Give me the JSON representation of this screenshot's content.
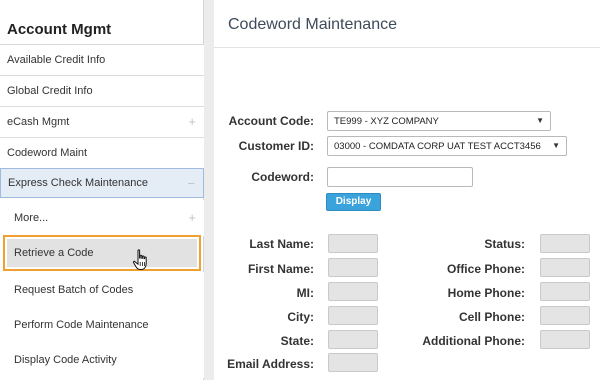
{
  "sidebar": {
    "title": "Account Mgmt",
    "items": [
      {
        "label": "Available Credit Info"
      },
      {
        "label": "Global Credit Info"
      },
      {
        "label": "eCash Mgmt",
        "icon": "plus-icon"
      },
      {
        "label": "Codeword Maint"
      },
      {
        "label": "Express Check Maintenance",
        "icon": "minus-icon"
      }
    ],
    "subitems": [
      {
        "label": "More...",
        "icon": "plus-icon"
      },
      {
        "label": "Retrieve a Code"
      },
      {
        "label": "Request Batch of Codes"
      },
      {
        "label": "Perform Code Maintenance"
      },
      {
        "label": "Display Code Activity"
      }
    ],
    "highlight_color": "#f0a030"
  },
  "main": {
    "title": "Codeword Maintenance",
    "form": {
      "account_code_label": "Account Code:",
      "account_code_value": "TE999 - XYZ COMPANY",
      "customer_id_label": "Customer ID:",
      "customer_id_value": "03000 - COMDATA CORP UAT TEST ACCT3456",
      "codeword_label": "Codeword:",
      "codeword_value": "",
      "display_button": "Display"
    },
    "details_left": [
      "Last Name:",
      "First Name:",
      "MI:",
      "City:",
      "State:",
      "Email Address:"
    ],
    "details_right": [
      "Status:",
      "Office Phone:",
      "Home Phone:",
      "Cell Phone:",
      "Additional Phone:"
    ],
    "accent_color": "#3aa3db"
  }
}
